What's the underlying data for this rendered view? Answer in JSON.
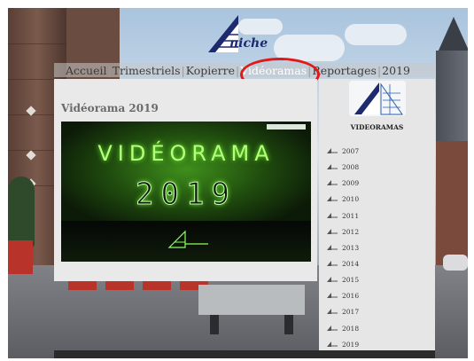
{
  "site": {
    "logo_text": "niche"
  },
  "nav": {
    "items": [
      "Accueil",
      "Trimestriels",
      "Kopierre",
      "Vidéoramas",
      "Reportages",
      "2019"
    ],
    "separator": "|",
    "active_index": 3
  },
  "main": {
    "title": "Vidéorama 2019",
    "video": {
      "title_line1": "VIDÉORAMA",
      "title_line2": "2019"
    }
  },
  "sidebar": {
    "title": "VIDEORAMAS",
    "years": [
      "2007",
      "2008",
      "2009",
      "2010",
      "2011",
      "2012",
      "2013",
      "2014",
      "2015",
      "2016",
      "2017",
      "2018",
      "2019"
    ]
  },
  "colors": {
    "highlight_ring": "#e01818",
    "active_nav": "#ffffff",
    "panel_bg": "#e9e9e9",
    "video_glow": "#6dff2d"
  },
  "icons": [
    "logo-icon",
    "video-logo-icon",
    "year-bullet-icon",
    "videoramas-thumbnail-icon"
  ]
}
